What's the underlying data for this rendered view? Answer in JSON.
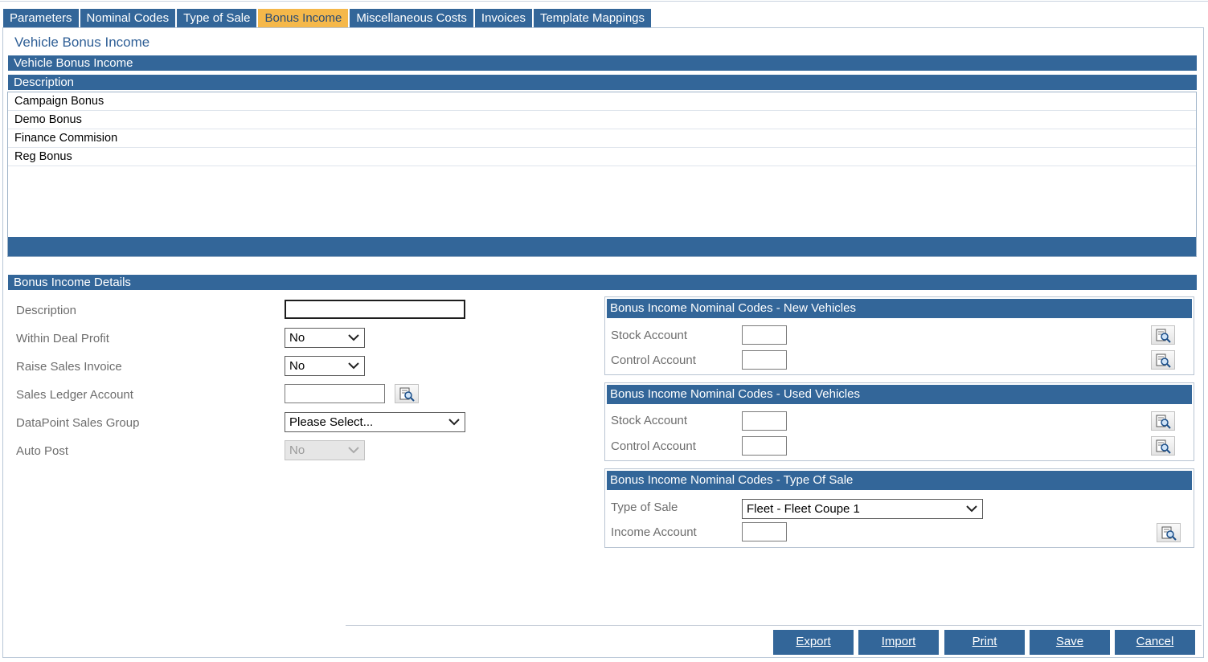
{
  "tabs": [
    "Parameters",
    "Nominal Codes",
    "Type of Sale",
    "Bonus Income",
    "Miscellaneous Costs",
    "Invoices",
    "Template Mappings"
  ],
  "active_tab": "Bonus Income",
  "page": {
    "title": "Vehicle Bonus Income",
    "grid_title": "Vehicle Bonus Income",
    "grid_column": "Description",
    "grid_rows": [
      "Campaign Bonus",
      "Demo Bonus",
      "Finance Commision",
      "Reg Bonus"
    ]
  },
  "details": {
    "title": "Bonus Income Details",
    "description_label": "Description",
    "description_value": "",
    "within_deal_profit_label": "Within Deal Profit",
    "within_deal_profit_value": "No",
    "raise_sales_invoice_label": "Raise Sales Invoice",
    "raise_sales_invoice_value": "No",
    "sales_ledger_label": "Sales Ledger Account",
    "sales_ledger_value": "",
    "datapoint_label": "DataPoint Sales Group",
    "datapoint_value": "Please Select...",
    "auto_post_label": "Auto Post",
    "auto_post_value": "No"
  },
  "new_vehicles": {
    "title": "Bonus Income Nominal Codes - New Vehicles",
    "stock_label": "Stock Account",
    "control_label": "Control Account"
  },
  "used_vehicles": {
    "title": "Bonus Income Nominal Codes - Used Vehicles",
    "stock_label": "Stock Account",
    "control_label": "Control Account"
  },
  "type_of_sale": {
    "title": "Bonus Income Nominal Codes - Type Of Sale",
    "type_label": "Type of Sale",
    "type_value": "Fleet - Fleet Coupe 1",
    "income_label": "Income Account"
  },
  "buttons": {
    "export": "Export",
    "import": "Import",
    "print": "Print",
    "save": "Save",
    "cancel": "Cancel"
  },
  "colors": {
    "header_blue": "#336699",
    "active_tab": "#f5b84a",
    "title_blue": "#2f5f96"
  },
  "icons": [
    "chevron-down-icon",
    "lookup-magnifier-icon"
  ]
}
